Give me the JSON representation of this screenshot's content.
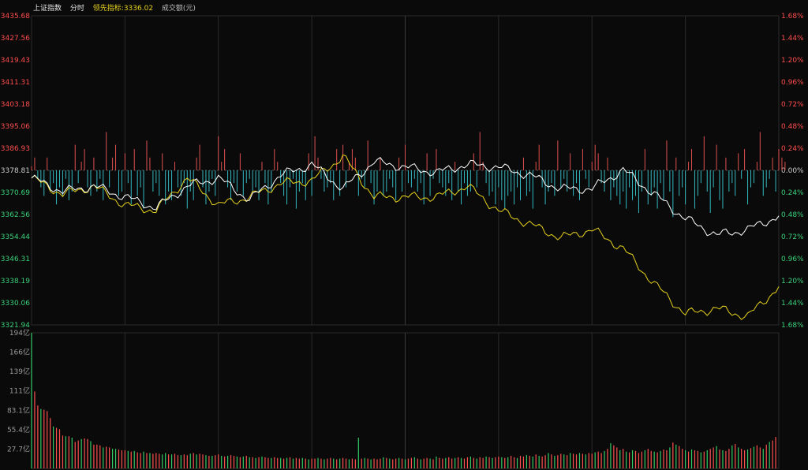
{
  "header": {
    "index_name": "上证指数",
    "period": "分时",
    "leading_label": "领先指标:",
    "leading_value": "3336.02",
    "volume_label": "成交额(元)"
  },
  "colors": {
    "background": "#0a0a0a",
    "grid": "#2a2a2a",
    "up": "#ff4d4d",
    "down": "#3ad07a",
    "neutral": "#cccccc",
    "price_line": "#ffffff",
    "leading_line": "#e6d21c",
    "bar_up": "#e05050",
    "bar_down": "#34b8c0",
    "vol_up": "#ff5050",
    "vol_down": "#33cc66"
  },
  "chart_data": [
    {
      "type": "line",
      "title": "",
      "y_ticks_left": [
        "3435.68",
        "3427.56",
        "3419.43",
        "3411.31",
        "3403.18",
        "3395.06",
        "3386.93",
        "3378.81",
        "3370.69",
        "3362.56",
        "3354.44",
        "3346.31",
        "3338.19",
        "3330.06",
        "3321.94"
      ],
      "y_ticks_right": [
        "1.68%",
        "1.44%",
        "1.20%",
        "0.96%",
        "0.72%",
        "0.48%",
        "0.24%",
        "0.00%",
        "0.24%",
        "0.48%",
        "0.72%",
        "0.96%",
        "1.20%",
        "1.44%",
        "1.68%"
      ],
      "ylim": [
        3321.94,
        3435.68
      ],
      "base": 3378.81,
      "x_points": 241,
      "series": [
        {
          "key": "price",
          "x": [
            0,
            10,
            20,
            30,
            40,
            50,
            60,
            70,
            80,
            90,
            100,
            110,
            120,
            130,
            140,
            150,
            160,
            170,
            180,
            190,
            200,
            210,
            220,
            230,
            240
          ],
          "y": [
            3376,
            3371,
            3373,
            3369,
            3365,
            3373,
            3376,
            3368,
            3377,
            3381,
            3372,
            3382,
            3380,
            3378,
            3381,
            3380,
            3377,
            3372,
            3372,
            3379,
            3370,
            3361,
            3355,
            3357,
            3362
          ]
        },
        {
          "key": "leading",
          "x": [
            0,
            10,
            20,
            30,
            40,
            50,
            60,
            70,
            80,
            90,
            100,
            110,
            120,
            130,
            140,
            150,
            160,
            170,
            180,
            190,
            200,
            210,
            220,
            230,
            240
          ],
          "y": [
            3376,
            3370,
            3373,
            3366,
            3364,
            3376,
            3366,
            3369,
            3374,
            3375,
            3384,
            3369,
            3369,
            3369,
            3373,
            3364,
            3359,
            3354,
            3357,
            3350,
            3337,
            3326,
            3328,
            3325,
            3336
          ]
        }
      ],
      "bars": [
        1,
        3,
        -2,
        -4,
        -6,
        3,
        -5,
        -3,
        -8,
        -4,
        -6,
        -2,
        -7,
        -5,
        6,
        -3,
        2,
        5,
        -4,
        -6,
        3,
        -5,
        -2,
        -7,
        9,
        -4,
        3,
        6,
        -6,
        -5,
        4,
        -3,
        -8,
        5,
        -6,
        -4,
        -9,
        7,
        3,
        -5,
        -3,
        -6,
        4,
        -8,
        -5,
        -7,
        2,
        -4,
        -6,
        -3,
        -9,
        -5,
        -7,
        3,
        6,
        -4,
        -8,
        -5,
        -2,
        -6,
        8,
        2,
        5,
        -4,
        -7,
        -3,
        -5,
        4,
        -6,
        -3,
        -2,
        -5,
        -4,
        -7,
        2,
        -3,
        -8,
        -5,
        5,
        2,
        -3,
        -6,
        -8,
        -4,
        -2,
        -9,
        -5,
        -3,
        -7,
        4,
        -6,
        8,
        3,
        -2,
        -5,
        -4,
        -3,
        -7,
        5,
        -6,
        6,
        -4,
        2,
        5,
        3,
        -6,
        -2,
        -4,
        7,
        -3,
        -8,
        -5,
        3,
        -6,
        -5,
        -2,
        -4,
        -7,
        3,
        -5,
        6,
        -3,
        -4,
        -2,
        -5,
        -3,
        -8,
        4,
        -6,
        -2,
        5,
        -3,
        -4,
        -6,
        -3,
        -7,
        2,
        -5,
        -8,
        -3,
        -6,
        -5,
        4,
        -4,
        9,
        2,
        -3,
        -6,
        -5,
        -8,
        -4,
        -7,
        -9,
        -6,
        -5,
        -8,
        -4,
        -7,
        3,
        -6,
        -5,
        -9,
        2,
        6,
        -4,
        -8,
        -5,
        -3,
        -6,
        7,
        -4,
        -2,
        -5,
        4,
        -6,
        -3,
        -7,
        5,
        -2,
        -4,
        2,
        6,
        4,
        -3,
        -5,
        3,
        -7,
        -4,
        -6,
        -8,
        -5,
        -9,
        -4,
        -7,
        -6,
        -10,
        -5,
        5,
        -8,
        -6,
        -4,
        -9,
        -3,
        -7,
        7,
        -5,
        -11,
        3,
        -6,
        -4,
        -8,
        2,
        5,
        -9,
        -6,
        -3,
        8,
        -5,
        -10,
        -4,
        6,
        -7,
        -9,
        3,
        -5,
        -3,
        -6,
        4,
        -2,
        5,
        -8,
        -4,
        -3,
        2,
        9,
        -6,
        -4,
        -2,
        3,
        -5,
        5,
        3,
        2
      ],
      "bar_scale": 12
    },
    {
      "type": "bar",
      "title": "",
      "y_ticks": [
        "194亿",
        "166亿",
        "139亿",
        "111亿",
        "83.1亿",
        "55.4亿",
        "27.7亿"
      ],
      "ylim": [
        0,
        194
      ],
      "values": [
        194,
        110,
        90,
        85,
        84,
        82,
        72,
        60,
        58,
        56,
        47,
        46,
        46,
        44,
        38,
        40,
        42,
        43,
        42,
        39,
        34,
        34,
        33,
        30,
        31,
        30,
        28,
        28,
        27,
        26,
        26,
        25,
        24,
        25,
        23,
        22,
        24,
        22,
        22,
        21,
        22,
        21,
        20,
        22,
        20,
        20,
        21,
        19,
        19,
        20,
        19,
        21,
        22,
        20,
        21,
        20,
        19,
        18,
        18,
        19,
        20,
        18,
        17,
        18,
        19,
        18,
        17,
        16,
        17,
        18,
        16,
        16,
        15,
        16,
        17,
        16,
        15,
        15,
        16,
        15,
        15,
        14,
        15,
        16,
        14,
        15,
        14,
        15,
        14,
        13,
        14,
        14,
        15,
        14,
        13,
        14,
        15,
        14,
        13,
        14,
        15,
        14,
        13,
        14,
        13,
        44,
        14,
        15,
        14,
        13,
        14,
        13,
        14,
        16,
        15,
        14,
        13,
        14,
        15,
        14,
        13,
        14,
        15,
        16,
        14,
        13,
        14,
        15,
        14,
        13,
        17,
        15,
        14,
        15,
        16,
        14,
        15,
        16,
        15,
        14,
        16,
        17,
        15,
        14,
        16,
        15,
        17,
        16,
        15,
        16,
        17,
        16,
        15,
        16,
        18,
        16,
        15,
        18,
        17,
        19,
        18,
        17,
        20,
        18,
        17,
        19,
        22,
        20,
        18,
        19,
        21,
        20,
        19,
        22,
        21,
        20,
        22,
        21,
        20,
        22,
        21,
        23,
        24,
        22,
        25,
        28,
        36,
        33,
        30,
        26,
        28,
        24,
        23,
        26,
        25,
        22,
        24,
        26,
        28,
        25,
        24,
        23,
        25,
        27,
        26,
        30,
        37,
        34,
        32,
        28,
        26,
        24,
        27,
        26,
        25,
        23,
        24,
        26,
        28,
        30,
        32,
        27,
        26,
        25,
        28,
        33,
        35,
        30,
        28,
        26,
        27,
        29,
        31,
        33,
        30,
        28,
        34,
        38,
        40,
        45
      ],
      "up_mask": "011011101110101101101110110011101011010111001011011010110101101011010101010110110101011010110101101011011010101110101101011010110101101101011010110101101011011010101101011010110101101101011010101110110101101011010110101101011010110101101011010110101"
    }
  ]
}
